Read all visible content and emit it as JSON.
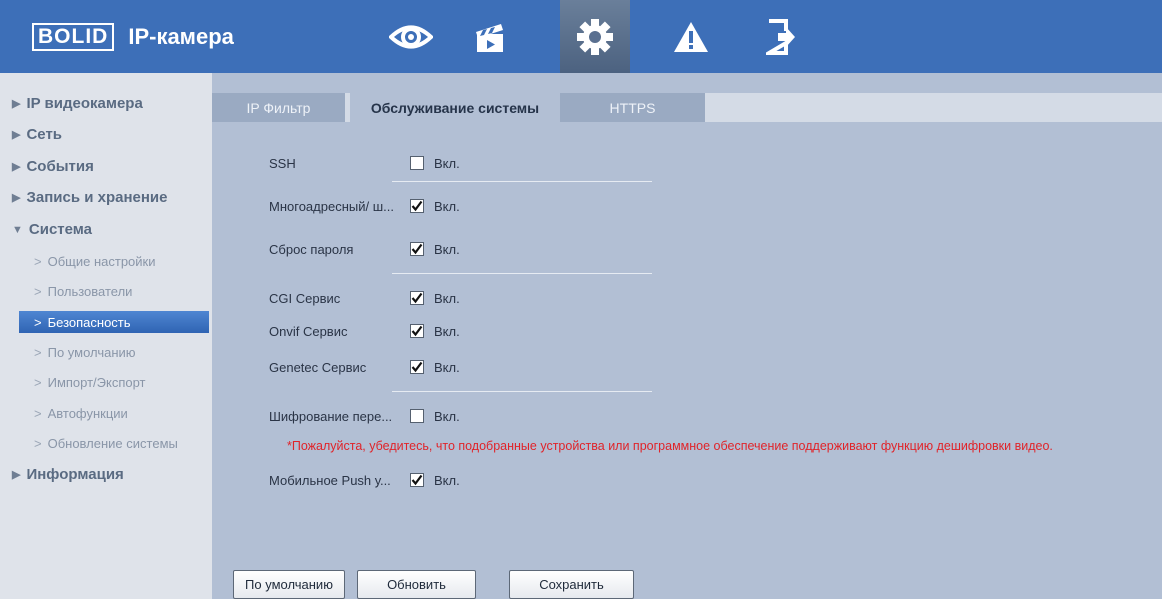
{
  "header": {
    "brand": "BOLID",
    "title": "IP-камера",
    "nav": [
      {
        "icon": "eye-icon"
      },
      {
        "icon": "clapperboard-icon"
      },
      {
        "icon": "gear-icon",
        "active": true
      },
      {
        "icon": "warning-icon"
      },
      {
        "icon": "logout-icon"
      }
    ],
    "colors": {
      "bar": "#3d6fb8",
      "active": "#5a7090"
    }
  },
  "sidebar": {
    "items": [
      {
        "label": "IP видеокамера",
        "expanded": false
      },
      {
        "label": "Сеть",
        "expanded": false
      },
      {
        "label": "События",
        "expanded": false
      },
      {
        "label": "Запись и хранение",
        "expanded": false
      },
      {
        "label": "Система",
        "expanded": true
      },
      {
        "label": "Информация",
        "expanded": false
      }
    ],
    "system_sub": [
      {
        "label": "Общие настройки"
      },
      {
        "label": "Пользователи"
      },
      {
        "label": "Безопасность",
        "active": true
      },
      {
        "label": "По умолчанию"
      },
      {
        "label": "Импорт/Экспорт"
      },
      {
        "label": "Автофункции"
      },
      {
        "label": "Обновление системы"
      }
    ]
  },
  "tabs": [
    {
      "label": "IP Фильтр"
    },
    {
      "label": "Обслуживание системы",
      "active": true
    },
    {
      "label": "HTTPS"
    }
  ],
  "settings": [
    {
      "label": "SSH",
      "checked": false,
      "value": "Вкл."
    },
    {
      "label": "Многоадресный/ ш...",
      "checked": true,
      "value": "Вкл."
    },
    {
      "label": "Сброс пароля",
      "checked": true,
      "value": "Вкл."
    },
    {
      "label": "CGI Сервис",
      "checked": true,
      "value": "Вкл."
    },
    {
      "label": "Onvif Сервис",
      "checked": true,
      "value": "Вкл."
    },
    {
      "label": "Genetec Сервис",
      "checked": true,
      "value": "Вкл."
    },
    {
      "label": "Шифрование пере...",
      "checked": false,
      "value": "Вкл."
    },
    {
      "label": "Мобильное Push у...",
      "checked": true,
      "value": "Вкл."
    }
  ],
  "note": "*Пожалуйста, убедитесь, что подобранные устройства или программное обеспечение поддерживают функцию дешифровки видео.",
  "buttons": {
    "default": "По умолчанию",
    "refresh": "Обновить",
    "save": "Сохранить"
  }
}
